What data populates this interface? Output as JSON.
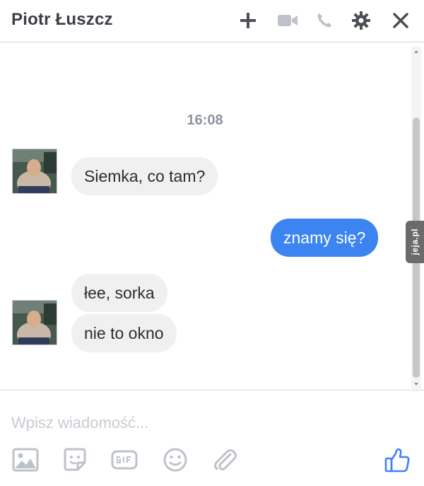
{
  "header": {
    "title": "Piotr Łuszcz",
    "icons": [
      "plus-icon",
      "video-call-icon",
      "phone-icon",
      "gear-icon",
      "close-icon"
    ]
  },
  "messages": {
    "timestamp": "16:08",
    "items": [
      {
        "direction": "incoming",
        "text": "Siemka, co tam?"
      },
      {
        "direction": "outgoing",
        "text": "znamy się?"
      },
      {
        "direction": "incoming",
        "text": "łee, sorka"
      },
      {
        "direction": "incoming",
        "text": "nie to okno"
      }
    ]
  },
  "watermark": {
    "text": "jeja.pl"
  },
  "composer": {
    "placeholder": "Wpisz wiadomość...",
    "value": "",
    "tools": [
      "image-icon",
      "sticker-icon",
      "gif-icon",
      "emoji-icon",
      "attachment-icon",
      "like-icon"
    ]
  },
  "colors": {
    "outgoing_bubble": "#3b84f2",
    "incoming_bubble": "#f1f0f0",
    "icon": "#4b4f56",
    "icon_muted": "#bec2c9",
    "like": "#4080ff"
  }
}
